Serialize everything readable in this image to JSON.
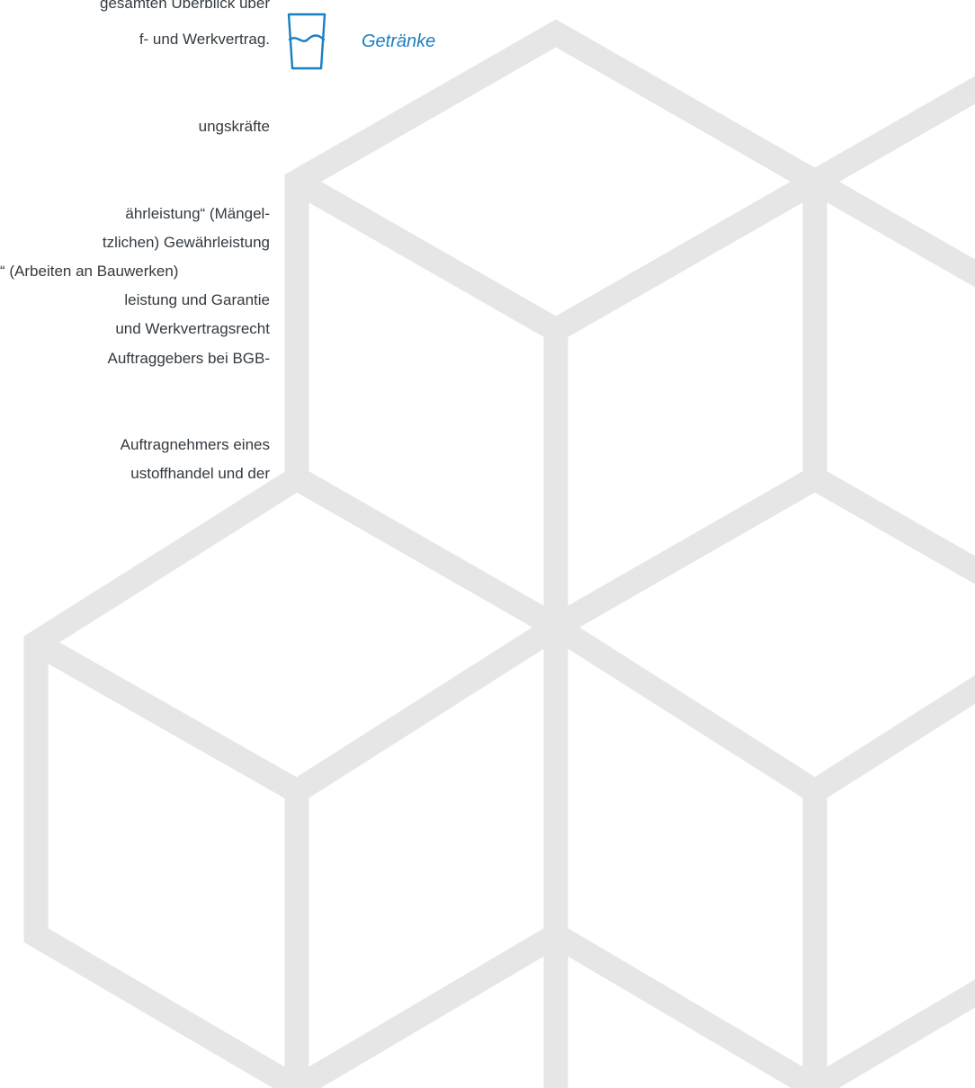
{
  "colors": {
    "accent": "#1a7fc1",
    "hexagon_stroke": "#e6e6e6",
    "text": "#333a40"
  },
  "text_column": {
    "lines": [
      "gesamten Überblick über",
      "f- und Werkvertrag.",
      "ungskräfte",
      "ährleistung“ (Mängel-",
      "tzlichen) Gewährleistung",
      "“ (Arbeiten an Bauwerken)",
      "leistung und Garantie",
      "und Werkvertragsrecht",
      "Auftraggebers bei BGB-",
      "Auftragnehmers eines",
      "ustoffhandel und der"
    ]
  },
  "category": {
    "icon": "glass-icon",
    "label": "Getränke"
  }
}
